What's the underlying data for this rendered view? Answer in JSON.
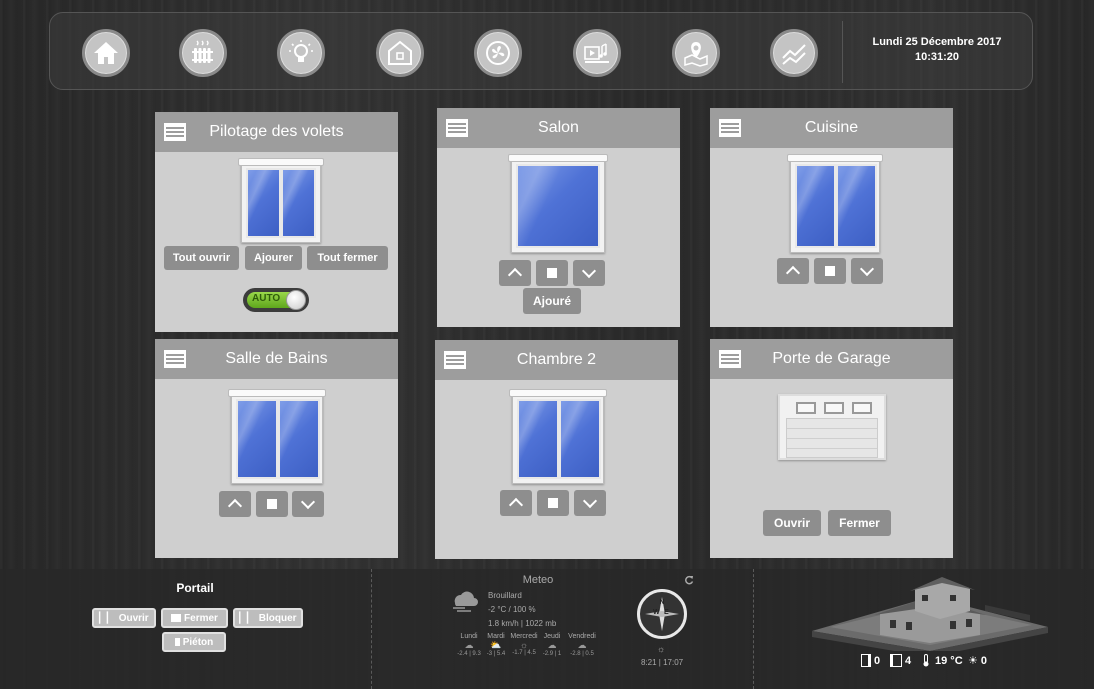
{
  "header": {
    "nav": [
      {
        "name": "nav-home",
        "icon": "house-icon"
      },
      {
        "name": "nav-heating",
        "icon": "radiator-icon"
      },
      {
        "name": "nav-lights",
        "icon": "lightbulb-icon"
      },
      {
        "name": "nav-security",
        "icon": "home-shield-icon"
      },
      {
        "name": "nav-ventilation",
        "icon": "fan-icon"
      },
      {
        "name": "nav-media",
        "icon": "media-icon"
      },
      {
        "name": "nav-map",
        "icon": "map-pin-icon"
      },
      {
        "name": "nav-graphs",
        "icon": "chart-icon"
      }
    ],
    "date": "Lundi 25 Décembre 2017",
    "time": "10:31:20"
  },
  "cards": {
    "pilotage": {
      "title": "Pilotage des volets",
      "btn_open": "Tout ouvrir",
      "btn_mid": "Ajourer",
      "btn_close": "Tout fermer",
      "auto_label": "AUTO"
    },
    "salon": {
      "title": "Salon",
      "state": "Ajouré"
    },
    "cuisine": {
      "title": "Cuisine"
    },
    "bains": {
      "title": "Salle de Bains"
    },
    "chambre2": {
      "title": "Chambre 2"
    },
    "garage": {
      "title": "Porte de Garage",
      "btn_open": "Ouvrir",
      "btn_close": "Fermer"
    }
  },
  "portail": {
    "title": "Portail",
    "btn_open": "Ouvrir",
    "btn_close": "Fermer",
    "btn_block": "Bloquer",
    "btn_pedestrian": "Piéton"
  },
  "meteo": {
    "title": "Meteo",
    "condition": "Brouillard",
    "temp_humidity": "-2 °C / 100 %",
    "wind_pressure": "1.8 km/h | 1022 mb",
    "days": [
      {
        "day": "Lundi",
        "range": "-2.4 | 9.3"
      },
      {
        "day": "Mardi",
        "range": "-3 | 5.4"
      },
      {
        "day": "Mercredi",
        "range": "-1.7 | 4.5"
      },
      {
        "day": "Jeudi",
        "range": "-2.9 | 1"
      },
      {
        "day": "Vendredi",
        "range": "-2.8 | 0.5"
      }
    ],
    "compass": {
      "n": "N",
      "w": "W",
      "e": "E"
    },
    "sun_times": "8:21 | 17:07"
  },
  "status": {
    "doors": "0",
    "windows": "4",
    "temperature": "19 °C",
    "lights": "0"
  },
  "colors": {
    "header_gray": "#9d9d9d",
    "card_bg": "#cfcfcf",
    "button_gray": "#8e8e8e",
    "auto_green": "#7cc233"
  }
}
